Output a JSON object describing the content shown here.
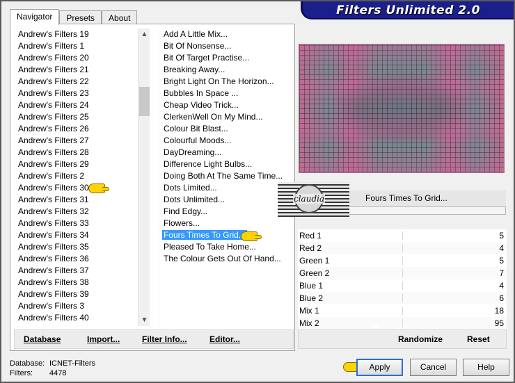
{
  "app_title": "Filters Unlimited 2.0",
  "tabs": [
    "Navigator",
    "Presets",
    "About"
  ],
  "categories": [
    "Andrew's Filters 19",
    "Andrew's Filters 1",
    "Andrew's Filters 20",
    "Andrew's Filters 21",
    "Andrew's Filters 22",
    "Andrew's Filters 23",
    "Andrew's Filters 24",
    "Andrew's Filters 25",
    "Andrew's Filters 26",
    "Andrew's Filters 27",
    "Andrew's Filters 28",
    "Andrew's Filters 29",
    "Andrew's Filters 2",
    "Andrew's Filters 30",
    "Andrew's Filters 31",
    "Andrew's Filters 32",
    "Andrew's Filters 33",
    "Andrew's Filters 34",
    "Andrew's Filters 35",
    "Andrew's Filters 36",
    "Andrew's Filters 37",
    "Andrew's Filters 38",
    "Andrew's Filters 39",
    "Andrew's Filters 3",
    "Andrew's Filters 40"
  ],
  "filters": [
    "Add A Little Mix...",
    "Bit Of Nonsense...",
    "Bit Of Target Practise...",
    "Breaking Away...",
    "Bright Light On The Horizon...",
    "Bubbles In Space ...",
    "Cheap Video Trick...",
    "ClerkenWell On My Mind...",
    "Colour Bit Blast...",
    "Colourful Moods...",
    "DayDreaming...",
    "Difference Light Bulbs...",
    "Doing Both At The Same Time...",
    "Dots Limited...",
    "Dots Unlimited...",
    "Find Edgy...",
    "Flowers...",
    "Fours Times To Grid...",
    "Pleased To Take Home...",
    "The Colour Gets Out Of Hand..."
  ],
  "selected_category": "Andrew's Filters 30",
  "selected_filter": "Fours Times To Grid...",
  "panel_buttons": {
    "database": "Database",
    "import": "Import...",
    "filter_info": "Filter Info...",
    "editor": "Editor..."
  },
  "current_filter_name": "Fours Times To Grid...",
  "watermark_text": "claudia",
  "params": [
    {
      "label": "Red 1",
      "value": "5"
    },
    {
      "label": "Red 2",
      "value": "4"
    },
    {
      "label": "Green 1",
      "value": "5"
    },
    {
      "label": "Green 2",
      "value": "7"
    },
    {
      "label": "Blue 1",
      "value": "4"
    },
    {
      "label": "Blue 2",
      "value": "6"
    },
    {
      "label": "Mix 1",
      "value": "18"
    },
    {
      "label": "Mix 2",
      "value": "95"
    }
  ],
  "right_buttons": {
    "randomize": "Randomize",
    "reset": "Reset"
  },
  "status": {
    "database_label": "Database:",
    "database_value": "ICNET-Filters",
    "filters_label": "Filters:",
    "filters_value": "4478"
  },
  "dialog_buttons": {
    "apply": "Apply",
    "cancel": "Cancel",
    "help": "Help"
  },
  "colors": {
    "banner": "#1b1f8a",
    "selection": "#3399ff",
    "pointer": "#ffd400"
  }
}
